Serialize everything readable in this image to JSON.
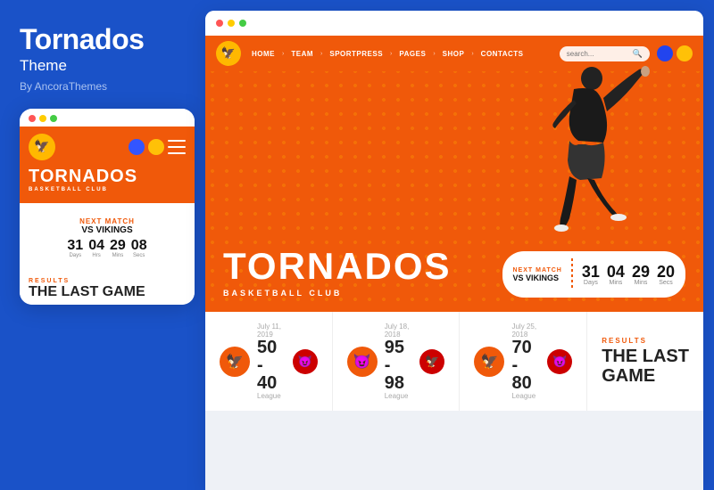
{
  "left": {
    "title": "Tornados",
    "subtitle": "Theme",
    "by": "By AncoraThemes",
    "mobile_card": {
      "dots": [
        "red",
        "yellow",
        "green"
      ],
      "hero": {
        "title": "TORNADOS",
        "subtitle": "BASKETBALL CLUB"
      },
      "next_match": {
        "label": "NEXT MATCH",
        "vs": "VS VIKINGS",
        "timer": [
          {
            "num": "31",
            "label": "Days"
          },
          {
            "num": "04",
            "label": "Hrs"
          },
          {
            "num": "29",
            "label": "Mins"
          },
          {
            "num": "08",
            "label": "Secs"
          }
        ]
      },
      "results_tag": "RESULTS",
      "results_title": "THE LAST GAME"
    }
  },
  "right": {
    "nav": {
      "links": [
        "HOME",
        "TEAM",
        "SPORTPRESS",
        "PAGES",
        "SHOP",
        "CONTACTS"
      ],
      "search_placeholder": "search..."
    },
    "hero": {
      "title": "TORNADOS",
      "subtitle": "BASKETBALL CLUB",
      "next_match": {
        "label": "NEXT MATCH",
        "vs": "VS VIKINGS",
        "timer": [
          {
            "num": "31",
            "label": "Days"
          },
          {
            "num": "04",
            "label": "Mins"
          },
          {
            "num": "29",
            "label": "Mins"
          },
          {
            "num": "20",
            "label": "Secs"
          }
        ]
      }
    },
    "results": [
      {
        "date": "July 11, 2019",
        "score": "50 - 40",
        "league": "League",
        "logo_left": "🦅",
        "logo_right": "😈"
      },
      {
        "date": "July 18, 2018",
        "score": "95 - 98",
        "league": "League",
        "logo_left": "😈",
        "logo_right": "🦅"
      },
      {
        "date": "July 25, 2018",
        "score": "70 - 80",
        "league": "League",
        "logo_left": "🦅",
        "logo_right": "😈"
      }
    ],
    "results_tag": "RESULTS",
    "results_title_line1": "THE LAST",
    "results_title_line2": "GAME"
  }
}
